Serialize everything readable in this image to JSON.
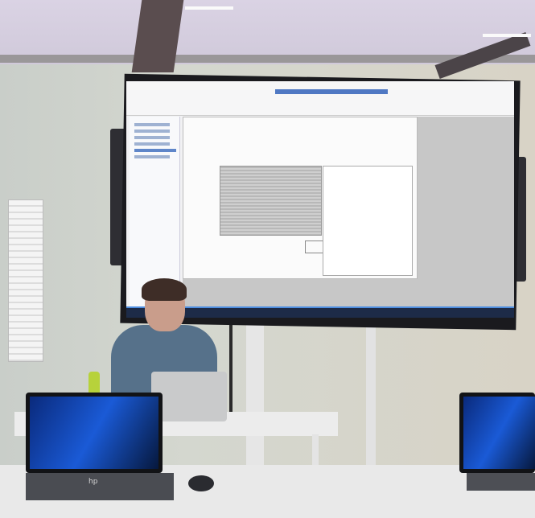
{
  "scene": {
    "description_tags": [
      "conference-room",
      "projector-screen",
      "presenter",
      "laptops"
    ],
    "colors": {
      "screen_background": "#f1f1f3",
      "taskbar": "#1d2b48",
      "accent": "#4d8de0",
      "wall": "#d4d7cf"
    }
  },
  "laptop_left": {
    "logo": "hp"
  }
}
